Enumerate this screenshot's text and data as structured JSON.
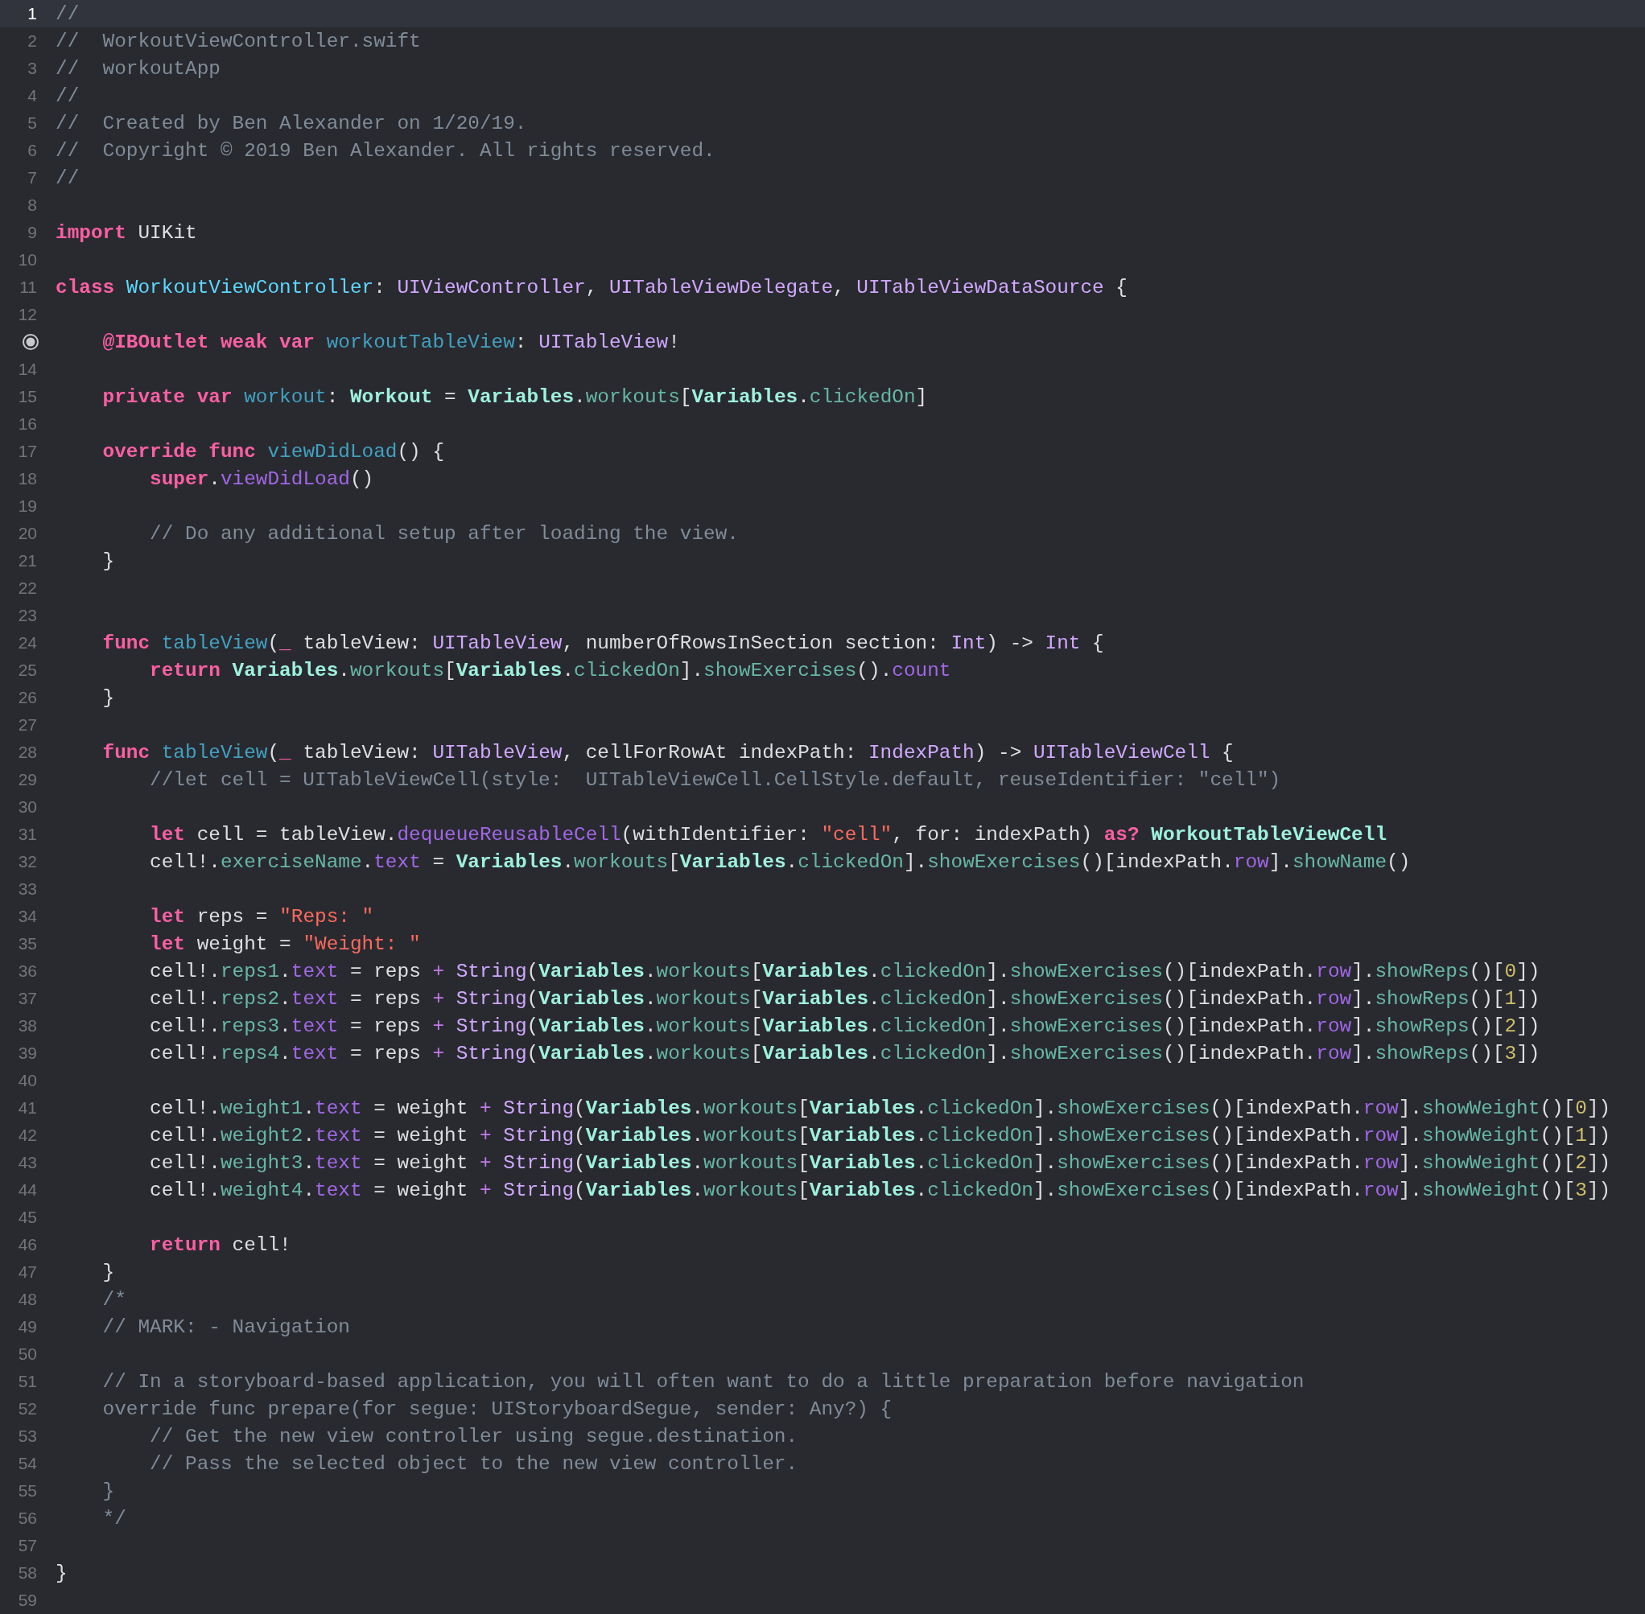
{
  "editor": {
    "lines": [
      {
        "kind": "numbered",
        "number": "1",
        "current": true,
        "tokens": [
          {
            "kind": "comment",
            "text": "//"
          }
        ]
      },
      {
        "kind": "numbered",
        "number": "2",
        "current": false,
        "tokens": [
          {
            "kind": "comment",
            "text": "//  WorkoutViewController.swift"
          }
        ]
      },
      {
        "kind": "numbered",
        "number": "3",
        "current": false,
        "tokens": [
          {
            "kind": "comment",
            "text": "//  workoutApp"
          }
        ]
      },
      {
        "kind": "numbered",
        "number": "4",
        "current": false,
        "tokens": [
          {
            "kind": "comment",
            "text": "//"
          }
        ]
      },
      {
        "kind": "numbered",
        "number": "5",
        "current": false,
        "tokens": [
          {
            "kind": "comment",
            "text": "//  Created by Ben Alexander on 1/20/19."
          }
        ]
      },
      {
        "kind": "numbered",
        "number": "6",
        "current": false,
        "tokens": [
          {
            "kind": "comment",
            "text": "//  Copyright © 2019 Ben Alexander. All rights reserved."
          }
        ]
      },
      {
        "kind": "numbered",
        "number": "7",
        "current": false,
        "tokens": [
          {
            "kind": "comment",
            "text": "//"
          }
        ]
      },
      {
        "kind": "numbered",
        "number": "8",
        "current": false
      },
      {
        "kind": "numbered",
        "number": "9",
        "current": false,
        "tokens": [
          {
            "kind": "keyword",
            "text": "import"
          },
          {
            "kind": "plain",
            "text": " UIKit"
          }
        ]
      },
      {
        "kind": "numbered",
        "number": "10",
        "current": false
      },
      {
        "kind": "numbered",
        "number": "11",
        "current": false,
        "tokens": [
          {
            "kind": "keyword",
            "text": "class "
          },
          {
            "kind": "class_decl",
            "text": "WorkoutViewController"
          },
          {
            "kind": "plain",
            "text": ": "
          },
          {
            "kind": "system_type",
            "text": "UIViewController"
          },
          {
            "kind": "plain",
            "text": ", "
          },
          {
            "kind": "system_type",
            "text": "UITableViewDelegate"
          },
          {
            "kind": "plain",
            "text": ", "
          },
          {
            "kind": "system_type",
            "text": "UITableViewDataSource"
          },
          {
            "kind": "plain",
            "text": " {"
          }
        ]
      },
      {
        "kind": "numbered",
        "number": "12",
        "current": false
      },
      {
        "kind": "outlet",
        "current": false,
        "tokens": [
          {
            "kind": "keyword",
            "text": "    @IBOutlet weak var "
          },
          {
            "kind": "decl",
            "text": "workoutTableView"
          },
          {
            "kind": "plain",
            "text": ": "
          },
          {
            "kind": "system_type",
            "text": "UITableView"
          },
          {
            "kind": "plain",
            "text": "!"
          }
        ]
      },
      {
        "kind": "numbered",
        "number": "14",
        "current": false
      },
      {
        "kind": "numbered",
        "number": "15",
        "current": false,
        "tokens": [
          {
            "kind": "keyword",
            "text": "    private var "
          },
          {
            "kind": "decl",
            "text": "workout"
          },
          {
            "kind": "plain",
            "text": ": "
          },
          {
            "kind": "project_type",
            "text": "Workout"
          },
          {
            "kind": "plain",
            "text": " = "
          },
          {
            "kind": "project_type",
            "text": "Variables"
          },
          {
            "kind": "plain",
            "text": "."
          },
          {
            "kind": "project_member",
            "text": "workouts"
          },
          {
            "kind": "plain",
            "text": "["
          },
          {
            "kind": "project_type",
            "text": "Variables"
          },
          {
            "kind": "plain",
            "text": "."
          },
          {
            "kind": "project_member",
            "text": "clickedOn"
          },
          {
            "kind": "plain",
            "text": "]"
          }
        ]
      },
      {
        "kind": "numbered",
        "number": "16",
        "current": false
      },
      {
        "kind": "numbered",
        "number": "17",
        "current": false,
        "tokens": [
          {
            "kind": "keyword",
            "text": "    override func "
          },
          {
            "kind": "decl",
            "text": "viewDidLoad"
          },
          {
            "kind": "plain",
            "text": "() {"
          }
        ]
      },
      {
        "kind": "numbered",
        "number": "18",
        "current": false,
        "tokens": [
          {
            "kind": "keyword",
            "text": "        super"
          },
          {
            "kind": "plain",
            "text": "."
          },
          {
            "kind": "system_member",
            "text": "viewDidLoad"
          },
          {
            "kind": "plain",
            "text": "()"
          }
        ]
      },
      {
        "kind": "numbered",
        "number": "19",
        "current": false
      },
      {
        "kind": "numbered",
        "number": "20",
        "current": false,
        "tokens": [
          {
            "kind": "comment",
            "text": "        // Do any additional setup after loading the view."
          }
        ]
      },
      {
        "kind": "numbered",
        "number": "21",
        "current": false,
        "tokens": [
          {
            "kind": "plain",
            "text": "    }"
          }
        ]
      },
      {
        "kind": "numbered",
        "number": "22",
        "current": false
      },
      {
        "kind": "numbered",
        "number": "23",
        "current": false
      },
      {
        "kind": "numbered",
        "number": "24",
        "current": false,
        "tokens": [
          {
            "kind": "keyword",
            "text": "    func "
          },
          {
            "kind": "decl",
            "text": "tableView"
          },
          {
            "kind": "plain",
            "text": "("
          },
          {
            "kind": "keyword",
            "text": "_"
          },
          {
            "kind": "plain",
            "text": " tableView: "
          },
          {
            "kind": "system_type",
            "text": "UITableView"
          },
          {
            "kind": "plain",
            "text": ", numberOfRowsInSection section: "
          },
          {
            "kind": "system_type",
            "text": "Int"
          },
          {
            "kind": "plain",
            "text": ") -> "
          },
          {
            "kind": "system_type",
            "text": "Int"
          },
          {
            "kind": "plain",
            "text": " {"
          }
        ]
      },
      {
        "kind": "numbered",
        "number": "25",
        "current": false,
        "tokens": [
          {
            "kind": "keyword",
            "text": "        return "
          },
          {
            "kind": "project_type",
            "text": "Variables"
          },
          {
            "kind": "plain",
            "text": "."
          },
          {
            "kind": "project_member",
            "text": "workouts"
          },
          {
            "kind": "plain",
            "text": "["
          },
          {
            "kind": "project_type",
            "text": "Variables"
          },
          {
            "kind": "plain",
            "text": "."
          },
          {
            "kind": "project_member",
            "text": "clickedOn"
          },
          {
            "kind": "plain",
            "text": "]."
          },
          {
            "kind": "project_member",
            "text": "showExercises"
          },
          {
            "kind": "plain",
            "text": "()."
          },
          {
            "kind": "system_member",
            "text": "count"
          }
        ]
      },
      {
        "kind": "numbered",
        "number": "26",
        "current": false,
        "tokens": [
          {
            "kind": "plain",
            "text": "    }"
          }
        ]
      },
      {
        "kind": "numbered",
        "number": "27",
        "current": false
      },
      {
        "kind": "numbered",
        "number": "28",
        "current": false,
        "tokens": [
          {
            "kind": "keyword",
            "text": "    func "
          },
          {
            "kind": "decl",
            "text": "tableView"
          },
          {
            "kind": "plain",
            "text": "("
          },
          {
            "kind": "keyword",
            "text": "_"
          },
          {
            "kind": "plain",
            "text": " tableView: "
          },
          {
            "kind": "system_type",
            "text": "UITableView"
          },
          {
            "kind": "plain",
            "text": ", cellForRowAt indexPath: "
          },
          {
            "kind": "system_type",
            "text": "IndexPath"
          },
          {
            "kind": "plain",
            "text": ") -> "
          },
          {
            "kind": "system_type",
            "text": "UITableViewCell"
          },
          {
            "kind": "plain",
            "text": " {"
          }
        ]
      },
      {
        "kind": "numbered",
        "number": "29",
        "current": false,
        "tokens": [
          {
            "kind": "comment",
            "text": "        //let cell = UITableViewCell(style:  UITableViewCell.CellStyle.default, reuseIdentifier: \"cell\")"
          }
        ]
      },
      {
        "kind": "numbered",
        "number": "30",
        "current": false
      },
      {
        "kind": "numbered",
        "number": "31",
        "current": false,
        "tokens": [
          {
            "kind": "keyword",
            "text": "        let"
          },
          {
            "kind": "plain",
            "text": " cell = tableView."
          },
          {
            "kind": "system_member",
            "text": "dequeueReusableCell"
          },
          {
            "kind": "plain",
            "text": "(withIdentifier: "
          },
          {
            "kind": "string",
            "text": "\"cell\""
          },
          {
            "kind": "plain",
            "text": ", for: indexPath) "
          },
          {
            "kind": "keyword",
            "text": "as? "
          },
          {
            "kind": "project_type",
            "text": "WorkoutTableViewCell"
          }
        ]
      },
      {
        "kind": "numbered",
        "number": "32",
        "current": false,
        "tokens": [
          {
            "kind": "plain",
            "text": "        cell!."
          },
          {
            "kind": "project_member",
            "text": "exerciseName"
          },
          {
            "kind": "plain",
            "text": "."
          },
          {
            "kind": "system_member",
            "text": "text"
          },
          {
            "kind": "plain",
            "text": " = "
          },
          {
            "kind": "project_type",
            "text": "Variables"
          },
          {
            "kind": "plain",
            "text": "."
          },
          {
            "kind": "project_member",
            "text": "workouts"
          },
          {
            "kind": "plain",
            "text": "["
          },
          {
            "kind": "project_type",
            "text": "Variables"
          },
          {
            "kind": "plain",
            "text": "."
          },
          {
            "kind": "project_member",
            "text": "clickedOn"
          },
          {
            "kind": "plain",
            "text": "]."
          },
          {
            "kind": "project_member",
            "text": "showExercises"
          },
          {
            "kind": "plain",
            "text": "()[indexPath."
          },
          {
            "kind": "system_member",
            "text": "row"
          },
          {
            "kind": "plain",
            "text": "]."
          },
          {
            "kind": "project_member",
            "text": "showName"
          },
          {
            "kind": "plain",
            "text": "()"
          }
        ]
      },
      {
        "kind": "numbered",
        "number": "33",
        "current": false
      },
      {
        "kind": "numbered",
        "number": "34",
        "current": false,
        "tokens": [
          {
            "kind": "keyword",
            "text": "        let"
          },
          {
            "kind": "plain",
            "text": " reps = "
          },
          {
            "kind": "string",
            "text": "\"Reps: \""
          }
        ]
      },
      {
        "kind": "numbered",
        "number": "35",
        "current": false,
        "tokens": [
          {
            "kind": "keyword",
            "text": "        let"
          },
          {
            "kind": "plain",
            "text": " weight = "
          },
          {
            "kind": "string",
            "text": "\"Weight: \""
          }
        ]
      },
      {
        "kind": "numbered",
        "number": "36",
        "current": false,
        "tokens": [
          {
            "kind": "plain",
            "text": "        cell!."
          },
          {
            "kind": "project_member",
            "text": "reps1"
          },
          {
            "kind": "plain",
            "text": "."
          },
          {
            "kind": "system_member",
            "text": "text"
          },
          {
            "kind": "plain",
            "text": " = reps "
          },
          {
            "kind": "operator",
            "text": "+ "
          },
          {
            "kind": "system_type",
            "text": "String"
          },
          {
            "kind": "plain",
            "text": "("
          },
          {
            "kind": "project_type",
            "text": "Variables"
          },
          {
            "kind": "plain",
            "text": "."
          },
          {
            "kind": "project_member",
            "text": "workouts"
          },
          {
            "kind": "plain",
            "text": "["
          },
          {
            "kind": "project_type",
            "text": "Variables"
          },
          {
            "kind": "plain",
            "text": "."
          },
          {
            "kind": "project_member",
            "text": "clickedOn"
          },
          {
            "kind": "plain",
            "text": "]."
          },
          {
            "kind": "project_member",
            "text": "showExercises"
          },
          {
            "kind": "plain",
            "text": "()[indexPath."
          },
          {
            "kind": "system_member",
            "text": "row"
          },
          {
            "kind": "plain",
            "text": "]."
          },
          {
            "kind": "project_member",
            "text": "showReps"
          },
          {
            "kind": "plain",
            "text": "()["
          },
          {
            "kind": "number",
            "text": "0"
          },
          {
            "kind": "plain",
            "text": "])"
          }
        ]
      },
      {
        "kind": "numbered",
        "number": "37",
        "current": false,
        "tokens": [
          {
            "kind": "plain",
            "text": "        cell!."
          },
          {
            "kind": "project_member",
            "text": "reps2"
          },
          {
            "kind": "plain",
            "text": "."
          },
          {
            "kind": "system_member",
            "text": "text"
          },
          {
            "kind": "plain",
            "text": " = reps "
          },
          {
            "kind": "operator",
            "text": "+ "
          },
          {
            "kind": "system_type",
            "text": "String"
          },
          {
            "kind": "plain",
            "text": "("
          },
          {
            "kind": "project_type",
            "text": "Variables"
          },
          {
            "kind": "plain",
            "text": "."
          },
          {
            "kind": "project_member",
            "text": "workouts"
          },
          {
            "kind": "plain",
            "text": "["
          },
          {
            "kind": "project_type",
            "text": "Variables"
          },
          {
            "kind": "plain",
            "text": "."
          },
          {
            "kind": "project_member",
            "text": "clickedOn"
          },
          {
            "kind": "plain",
            "text": "]."
          },
          {
            "kind": "project_member",
            "text": "showExercises"
          },
          {
            "kind": "plain",
            "text": "()[indexPath."
          },
          {
            "kind": "system_member",
            "text": "row"
          },
          {
            "kind": "plain",
            "text": "]."
          },
          {
            "kind": "project_member",
            "text": "showReps"
          },
          {
            "kind": "plain",
            "text": "()["
          },
          {
            "kind": "number",
            "text": "1"
          },
          {
            "kind": "plain",
            "text": "])"
          }
        ]
      },
      {
        "kind": "numbered",
        "number": "38",
        "current": false,
        "tokens": [
          {
            "kind": "plain",
            "text": "        cell!."
          },
          {
            "kind": "project_member",
            "text": "reps3"
          },
          {
            "kind": "plain",
            "text": "."
          },
          {
            "kind": "system_member",
            "text": "text"
          },
          {
            "kind": "plain",
            "text": " = reps "
          },
          {
            "kind": "operator",
            "text": "+ "
          },
          {
            "kind": "system_type",
            "text": "String"
          },
          {
            "kind": "plain",
            "text": "("
          },
          {
            "kind": "project_type",
            "text": "Variables"
          },
          {
            "kind": "plain",
            "text": "."
          },
          {
            "kind": "project_member",
            "text": "workouts"
          },
          {
            "kind": "plain",
            "text": "["
          },
          {
            "kind": "project_type",
            "text": "Variables"
          },
          {
            "kind": "plain",
            "text": "."
          },
          {
            "kind": "project_member",
            "text": "clickedOn"
          },
          {
            "kind": "plain",
            "text": "]."
          },
          {
            "kind": "project_member",
            "text": "showExercises"
          },
          {
            "kind": "plain",
            "text": "()[indexPath."
          },
          {
            "kind": "system_member",
            "text": "row"
          },
          {
            "kind": "plain",
            "text": "]."
          },
          {
            "kind": "project_member",
            "text": "showReps"
          },
          {
            "kind": "plain",
            "text": "()["
          },
          {
            "kind": "number",
            "text": "2"
          },
          {
            "kind": "plain",
            "text": "])"
          }
        ]
      },
      {
        "kind": "numbered",
        "number": "39",
        "current": false,
        "tokens": [
          {
            "kind": "plain",
            "text": "        cell!."
          },
          {
            "kind": "project_member",
            "text": "reps4"
          },
          {
            "kind": "plain",
            "text": "."
          },
          {
            "kind": "system_member",
            "text": "text"
          },
          {
            "kind": "plain",
            "text": " = reps "
          },
          {
            "kind": "operator",
            "text": "+ "
          },
          {
            "kind": "system_type",
            "text": "String"
          },
          {
            "kind": "plain",
            "text": "("
          },
          {
            "kind": "project_type",
            "text": "Variables"
          },
          {
            "kind": "plain",
            "text": "."
          },
          {
            "kind": "project_member",
            "text": "workouts"
          },
          {
            "kind": "plain",
            "text": "["
          },
          {
            "kind": "project_type",
            "text": "Variables"
          },
          {
            "kind": "plain",
            "text": "."
          },
          {
            "kind": "project_member",
            "text": "clickedOn"
          },
          {
            "kind": "plain",
            "text": "]."
          },
          {
            "kind": "project_member",
            "text": "showExercises"
          },
          {
            "kind": "plain",
            "text": "()[indexPath."
          },
          {
            "kind": "system_member",
            "text": "row"
          },
          {
            "kind": "plain",
            "text": "]."
          },
          {
            "kind": "project_member",
            "text": "showReps"
          },
          {
            "kind": "plain",
            "text": "()["
          },
          {
            "kind": "number",
            "text": "3"
          },
          {
            "kind": "plain",
            "text": "])"
          }
        ]
      },
      {
        "kind": "numbered",
        "number": "40",
        "current": false
      },
      {
        "kind": "numbered",
        "number": "41",
        "current": false,
        "tokens": [
          {
            "kind": "plain",
            "text": "        cell!."
          },
          {
            "kind": "project_member",
            "text": "weight1"
          },
          {
            "kind": "plain",
            "text": "."
          },
          {
            "kind": "system_member",
            "text": "text"
          },
          {
            "kind": "plain",
            "text": " = weight "
          },
          {
            "kind": "operator",
            "text": "+ "
          },
          {
            "kind": "system_type",
            "text": "String"
          },
          {
            "kind": "plain",
            "text": "("
          },
          {
            "kind": "project_type",
            "text": "Variables"
          },
          {
            "kind": "plain",
            "text": "."
          },
          {
            "kind": "project_member",
            "text": "workouts"
          },
          {
            "kind": "plain",
            "text": "["
          },
          {
            "kind": "project_type",
            "text": "Variables"
          },
          {
            "kind": "plain",
            "text": "."
          },
          {
            "kind": "project_member",
            "text": "clickedOn"
          },
          {
            "kind": "plain",
            "text": "]."
          },
          {
            "kind": "project_member",
            "text": "showExercises"
          },
          {
            "kind": "plain",
            "text": "()[indexPath."
          },
          {
            "kind": "system_member",
            "text": "row"
          },
          {
            "kind": "plain",
            "text": "]."
          },
          {
            "kind": "project_member",
            "text": "showWeight"
          },
          {
            "kind": "plain",
            "text": "()["
          },
          {
            "kind": "number",
            "text": "0"
          },
          {
            "kind": "plain",
            "text": "])"
          }
        ]
      },
      {
        "kind": "numbered",
        "number": "42",
        "current": false,
        "tokens": [
          {
            "kind": "plain",
            "text": "        cell!."
          },
          {
            "kind": "project_member",
            "text": "weight2"
          },
          {
            "kind": "plain",
            "text": "."
          },
          {
            "kind": "system_member",
            "text": "text"
          },
          {
            "kind": "plain",
            "text": " = weight "
          },
          {
            "kind": "operator",
            "text": "+ "
          },
          {
            "kind": "system_type",
            "text": "String"
          },
          {
            "kind": "plain",
            "text": "("
          },
          {
            "kind": "project_type",
            "text": "Variables"
          },
          {
            "kind": "plain",
            "text": "."
          },
          {
            "kind": "project_member",
            "text": "workouts"
          },
          {
            "kind": "plain",
            "text": "["
          },
          {
            "kind": "project_type",
            "text": "Variables"
          },
          {
            "kind": "plain",
            "text": "."
          },
          {
            "kind": "project_member",
            "text": "clickedOn"
          },
          {
            "kind": "plain",
            "text": "]."
          },
          {
            "kind": "project_member",
            "text": "showExercises"
          },
          {
            "kind": "plain",
            "text": "()[indexPath."
          },
          {
            "kind": "system_member",
            "text": "row"
          },
          {
            "kind": "plain",
            "text": "]."
          },
          {
            "kind": "project_member",
            "text": "showWeight"
          },
          {
            "kind": "plain",
            "text": "()["
          },
          {
            "kind": "number",
            "text": "1"
          },
          {
            "kind": "plain",
            "text": "])"
          }
        ]
      },
      {
        "kind": "numbered",
        "number": "43",
        "current": false,
        "tokens": [
          {
            "kind": "plain",
            "text": "        cell!."
          },
          {
            "kind": "project_member",
            "text": "weight3"
          },
          {
            "kind": "plain",
            "text": "."
          },
          {
            "kind": "system_member",
            "text": "text"
          },
          {
            "kind": "plain",
            "text": " = weight "
          },
          {
            "kind": "operator",
            "text": "+ "
          },
          {
            "kind": "system_type",
            "text": "String"
          },
          {
            "kind": "plain",
            "text": "("
          },
          {
            "kind": "project_type",
            "text": "Variables"
          },
          {
            "kind": "plain",
            "text": "."
          },
          {
            "kind": "project_member",
            "text": "workouts"
          },
          {
            "kind": "plain",
            "text": "["
          },
          {
            "kind": "project_type",
            "text": "Variables"
          },
          {
            "kind": "plain",
            "text": "."
          },
          {
            "kind": "project_member",
            "text": "clickedOn"
          },
          {
            "kind": "plain",
            "text": "]."
          },
          {
            "kind": "project_member",
            "text": "showExercises"
          },
          {
            "kind": "plain",
            "text": "()[indexPath."
          },
          {
            "kind": "system_member",
            "text": "row"
          },
          {
            "kind": "plain",
            "text": "]."
          },
          {
            "kind": "project_member",
            "text": "showWeight"
          },
          {
            "kind": "plain",
            "text": "()["
          },
          {
            "kind": "number",
            "text": "2"
          },
          {
            "kind": "plain",
            "text": "])"
          }
        ]
      },
      {
        "kind": "numbered",
        "number": "44",
        "current": false,
        "tokens": [
          {
            "kind": "plain",
            "text": "        cell!."
          },
          {
            "kind": "project_member",
            "text": "weight4"
          },
          {
            "kind": "plain",
            "text": "."
          },
          {
            "kind": "system_member",
            "text": "text"
          },
          {
            "kind": "plain",
            "text": " = weight "
          },
          {
            "kind": "operator",
            "text": "+ "
          },
          {
            "kind": "system_type",
            "text": "String"
          },
          {
            "kind": "plain",
            "text": "("
          },
          {
            "kind": "project_type",
            "text": "Variables"
          },
          {
            "kind": "plain",
            "text": "."
          },
          {
            "kind": "project_member",
            "text": "workouts"
          },
          {
            "kind": "plain",
            "text": "["
          },
          {
            "kind": "project_type",
            "text": "Variables"
          },
          {
            "kind": "plain",
            "text": "."
          },
          {
            "kind": "project_member",
            "text": "clickedOn"
          },
          {
            "kind": "plain",
            "text": "]."
          },
          {
            "kind": "project_member",
            "text": "showExercises"
          },
          {
            "kind": "plain",
            "text": "()[indexPath."
          },
          {
            "kind": "system_member",
            "text": "row"
          },
          {
            "kind": "plain",
            "text": "]."
          },
          {
            "kind": "project_member",
            "text": "showWeight"
          },
          {
            "kind": "plain",
            "text": "()["
          },
          {
            "kind": "number",
            "text": "3"
          },
          {
            "kind": "plain",
            "text": "])"
          }
        ]
      },
      {
        "kind": "numbered",
        "number": "45",
        "current": false
      },
      {
        "kind": "numbered",
        "number": "46",
        "current": false,
        "tokens": [
          {
            "kind": "keyword",
            "text": "        return"
          },
          {
            "kind": "plain",
            "text": " cell!"
          }
        ]
      },
      {
        "kind": "numbered",
        "number": "47",
        "current": false,
        "tokens": [
          {
            "kind": "plain",
            "text": "    }"
          }
        ]
      },
      {
        "kind": "numbered",
        "number": "48",
        "current": false,
        "tokens": [
          {
            "kind": "comment",
            "text": "    /*"
          }
        ]
      },
      {
        "kind": "numbered",
        "number": "49",
        "current": false,
        "tokens": [
          {
            "kind": "comment",
            "text": "    // MARK: - Navigation"
          }
        ]
      },
      {
        "kind": "numbered",
        "number": "50",
        "current": false
      },
      {
        "kind": "numbered",
        "number": "51",
        "current": false,
        "tokens": [
          {
            "kind": "comment",
            "text": "    // In a storyboard-based application, you will often want to do a little preparation before navigation"
          }
        ]
      },
      {
        "kind": "numbered",
        "number": "52",
        "current": false,
        "tokens": [
          {
            "kind": "comment",
            "text": "    override func prepare(for segue: UIStoryboardSegue, sender: Any?) {"
          }
        ]
      },
      {
        "kind": "numbered",
        "number": "53",
        "current": false,
        "tokens": [
          {
            "kind": "comment",
            "text": "        // Get the new view controller using segue.destination."
          }
        ]
      },
      {
        "kind": "numbered",
        "number": "54",
        "current": false,
        "tokens": [
          {
            "kind": "comment",
            "text": "        // Pass the selected object to the new view controller."
          }
        ]
      },
      {
        "kind": "numbered",
        "number": "55",
        "current": false,
        "tokens": [
          {
            "kind": "comment",
            "text": "    }"
          }
        ]
      },
      {
        "kind": "numbered",
        "number": "56",
        "current": false,
        "tokens": [
          {
            "kind": "comment",
            "text": "    */"
          }
        ]
      },
      {
        "kind": "numbered",
        "number": "57",
        "current": false
      },
      {
        "kind": "numbered",
        "number": "58",
        "current": false,
        "tokens": [
          {
            "kind": "plain",
            "text": "}"
          }
        ]
      },
      {
        "kind": "numbered",
        "number": "59",
        "current": false
      }
    ]
  }
}
